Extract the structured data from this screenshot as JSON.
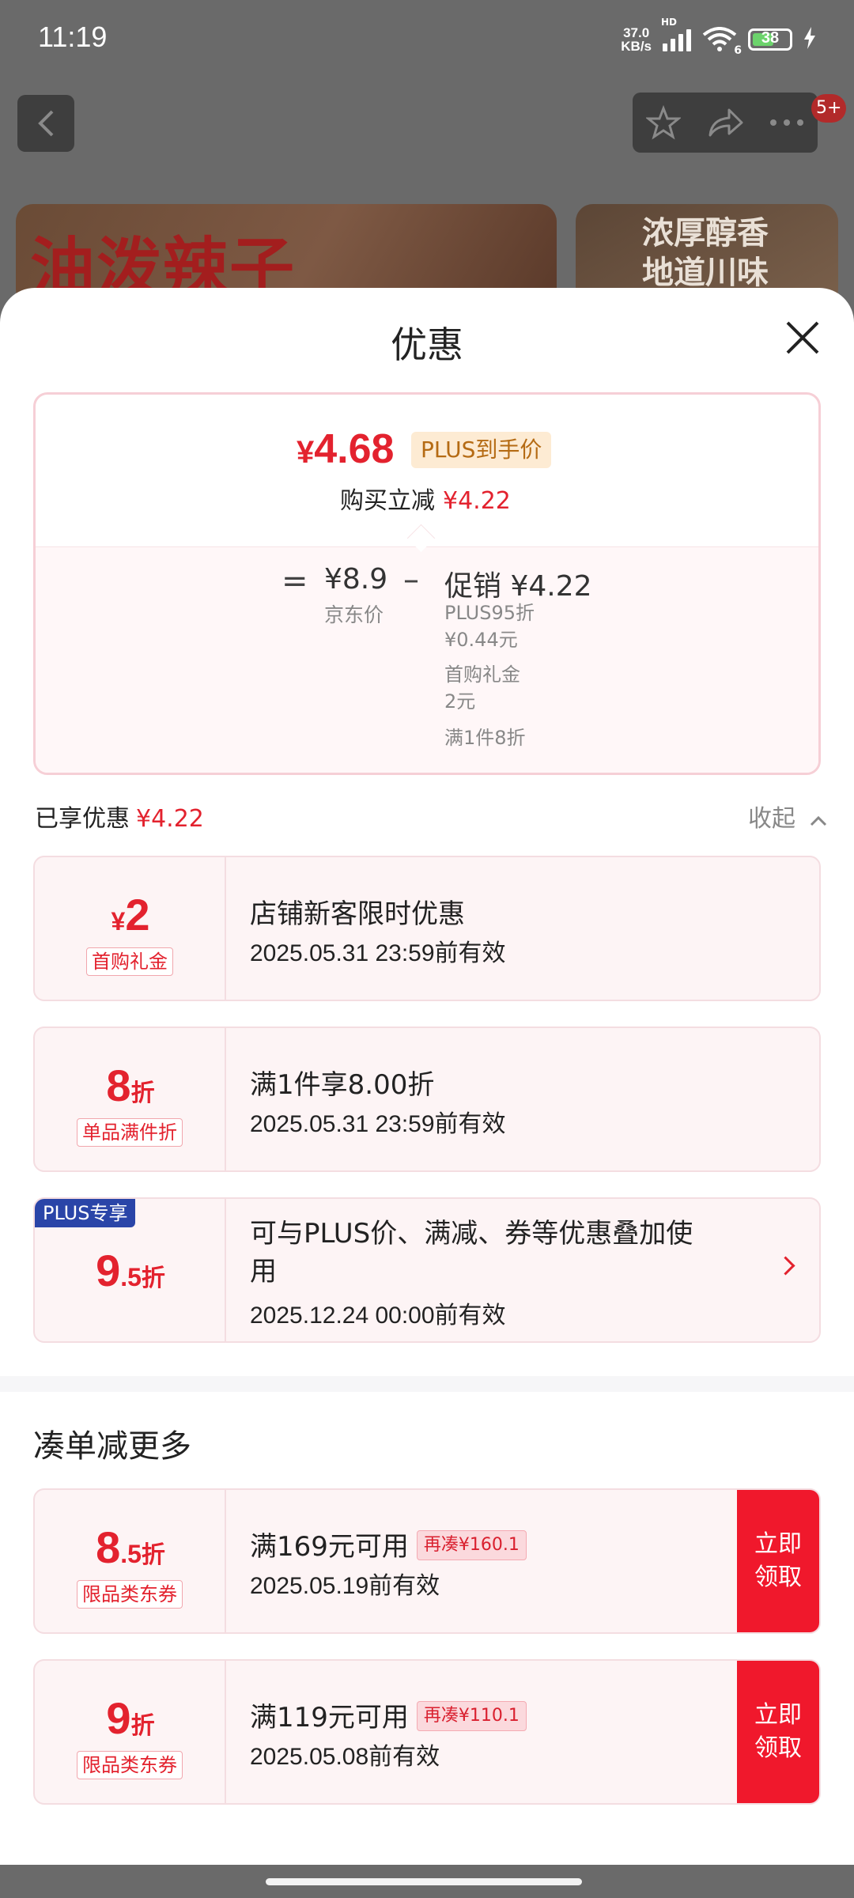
{
  "status": {
    "time": "11:19",
    "speed_top": "37.0",
    "speed_bottom": "KB/s",
    "network": "HD",
    "wifi": "6",
    "battery": "38"
  },
  "header": {
    "badge": "5+",
    "icons": [
      "back-icon",
      "star-icon",
      "share-icon",
      "more-icon"
    ]
  },
  "banners": {
    "left": "油泼辣子",
    "right_line1": "浓厚醇香",
    "right_line2": "地道川味"
  },
  "sheet": {
    "title": "优惠"
  },
  "price": {
    "symbol": "¥",
    "amount": "4.68",
    "plus_tag": "PLUS到手价",
    "instant_label": "购买立减",
    "instant_value": "¥4.22",
    "eq": "=",
    "jd_price": "¥8.9",
    "jd_label": "京东价",
    "minus": "–",
    "promo": "促销 ¥4.22",
    "promo_lines": [
      "PLUS95折",
      "¥0.44元",
      "首购礼金",
      "2元",
      "满1件8折"
    ]
  },
  "enjoyed": {
    "label": "已享优惠",
    "value": "¥4.22",
    "collapse": "收起"
  },
  "coupons": [
    {
      "amount_symbol": "¥",
      "amount": "2",
      "tag": "首购礼金",
      "title": "店铺新客限时优惠",
      "date": "2025.05.31 23:59前有效"
    },
    {
      "amount": "8",
      "unit": "折",
      "tag": "单品满件折",
      "title": "满1件享8.00折",
      "date": "2025.05.31 23:59前有效"
    },
    {
      "plus_label": "PLUS专享",
      "amount": "9",
      "amount_dec": ".5",
      "unit": "折",
      "title_line1": "可与PLUS价、满减、券等优惠叠加使",
      "title_line2": "用",
      "date": "2025.12.24 00:00前有效"
    }
  ],
  "section2": {
    "title": "凑单减更多"
  },
  "more_coupons": [
    {
      "amount": "8",
      "amount_dec": ".5",
      "unit": "折",
      "tag": "限品类东券",
      "title": "满169元可用",
      "need": "再凑¥160.1",
      "date": "2025.05.19前有效",
      "button": "立即领取"
    },
    {
      "amount": "9",
      "unit": "折",
      "tag": "限品类东券",
      "title": "满119元可用",
      "need": "再凑¥110.1",
      "date": "2025.05.08前有效",
      "button": "立即领取"
    }
  ],
  "colors": {
    "accent_red": "#e3222e",
    "button_red": "#f0182c",
    "plus_blue": "#2a45a8",
    "plus_tag_bg": "#fdebd3"
  }
}
